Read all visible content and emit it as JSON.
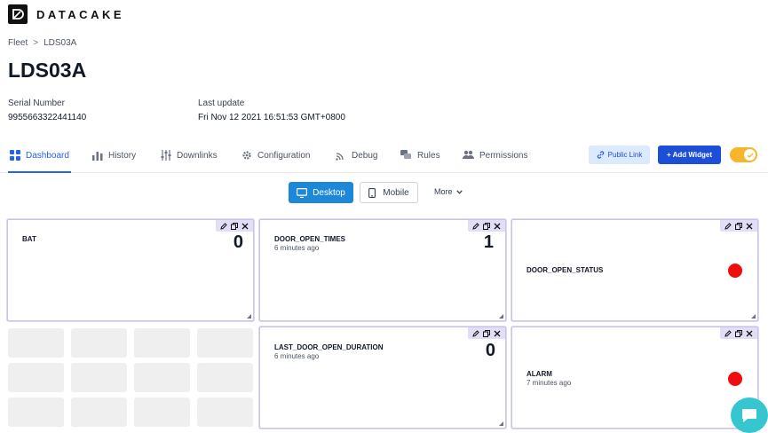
{
  "brand": {
    "name": "DATACAKE"
  },
  "breadcrumb": {
    "parent": "Fleet",
    "separator": ">",
    "current": "LDS03A"
  },
  "page": {
    "title": "LDS03A"
  },
  "meta": {
    "serial_label": "Serial Number",
    "serial_value": "9955663322441140",
    "update_label": "Last update",
    "update_value": "Fri Nov 12 2021 16:51:53 GMT+0800"
  },
  "tabs": [
    {
      "label": "Dashboard",
      "icon": "grid-icon",
      "active": true
    },
    {
      "label": "History",
      "icon": "bar-chart-icon"
    },
    {
      "label": "Downlinks",
      "icon": "sliders-icon"
    },
    {
      "label": "Configuration",
      "icon": "gear-icon"
    },
    {
      "label": "Debug",
      "icon": "signal-icon"
    },
    {
      "label": "Rules",
      "icon": "chat-icon"
    },
    {
      "label": "Permissions",
      "icon": "users-icon"
    }
  ],
  "actions": {
    "public_link": "Public Link",
    "add_widget": "+ Add Widget",
    "toggle_on": true
  },
  "view": {
    "desktop": "Desktop",
    "mobile": "Mobile",
    "more": "More"
  },
  "widgets": [
    {
      "title": "BAT",
      "subtitle": "",
      "value": "0",
      "type": "value"
    },
    {
      "title": "DOOR_OPEN_TIMES",
      "subtitle": "6 minutes ago",
      "value": "1",
      "type": "value"
    },
    {
      "title": "DOOR_OPEN_STATUS",
      "subtitle": "",
      "type": "status",
      "status_color": "#ef0d0d"
    },
    {
      "title": "LAST_DOOR_OPEN_DURATION",
      "subtitle": "6 minutes ago",
      "value": "0",
      "type": "value"
    },
    {
      "title": "ALARM",
      "subtitle": "7 minutes ago",
      "type": "status",
      "status_color": "#ef0d0d"
    }
  ],
  "colors": {
    "accent": "#2563eb",
    "primary_button": "#1d4ed8",
    "desktop_button": "#1e88d8",
    "toggle": "#f6b52b",
    "status_red": "#ef0d0d",
    "chat": "#35c6cf"
  }
}
